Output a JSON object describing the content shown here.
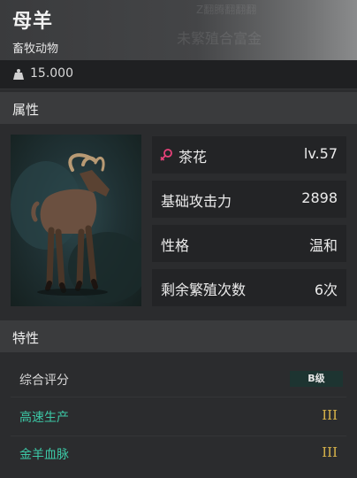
{
  "header": {
    "title": "母羊",
    "subtitle": "畜牧动物",
    "ghost_top": "Z翻腾翻翻翻",
    "ghost_bottom": "未繁殖合富金"
  },
  "price": {
    "value": "15.000",
    "icon": "weight-icon"
  },
  "sections": {
    "attributes": "属性",
    "traits": "特性"
  },
  "stats": [
    {
      "label": "茶花",
      "value": "lv.57",
      "icon": "female-icon",
      "icon_color": "#e8427a"
    },
    {
      "label": "基础攻击力",
      "value": "2898"
    },
    {
      "label": "性格",
      "value": "温和"
    },
    {
      "label": "剩余繁殖次数",
      "value": "6次"
    }
  ],
  "traits": {
    "rating_label": "综合评分",
    "rating_value": "B级",
    "items": [
      {
        "label": "高速生产",
        "level": "III",
        "color": "#3cc8a6"
      },
      {
        "label": "金羊血脉",
        "level": "III",
        "color": "#3cc8a6"
      }
    ]
  },
  "colors": {
    "accent_teal": "#3cc8a6",
    "level_gold": "#d8b44a"
  }
}
